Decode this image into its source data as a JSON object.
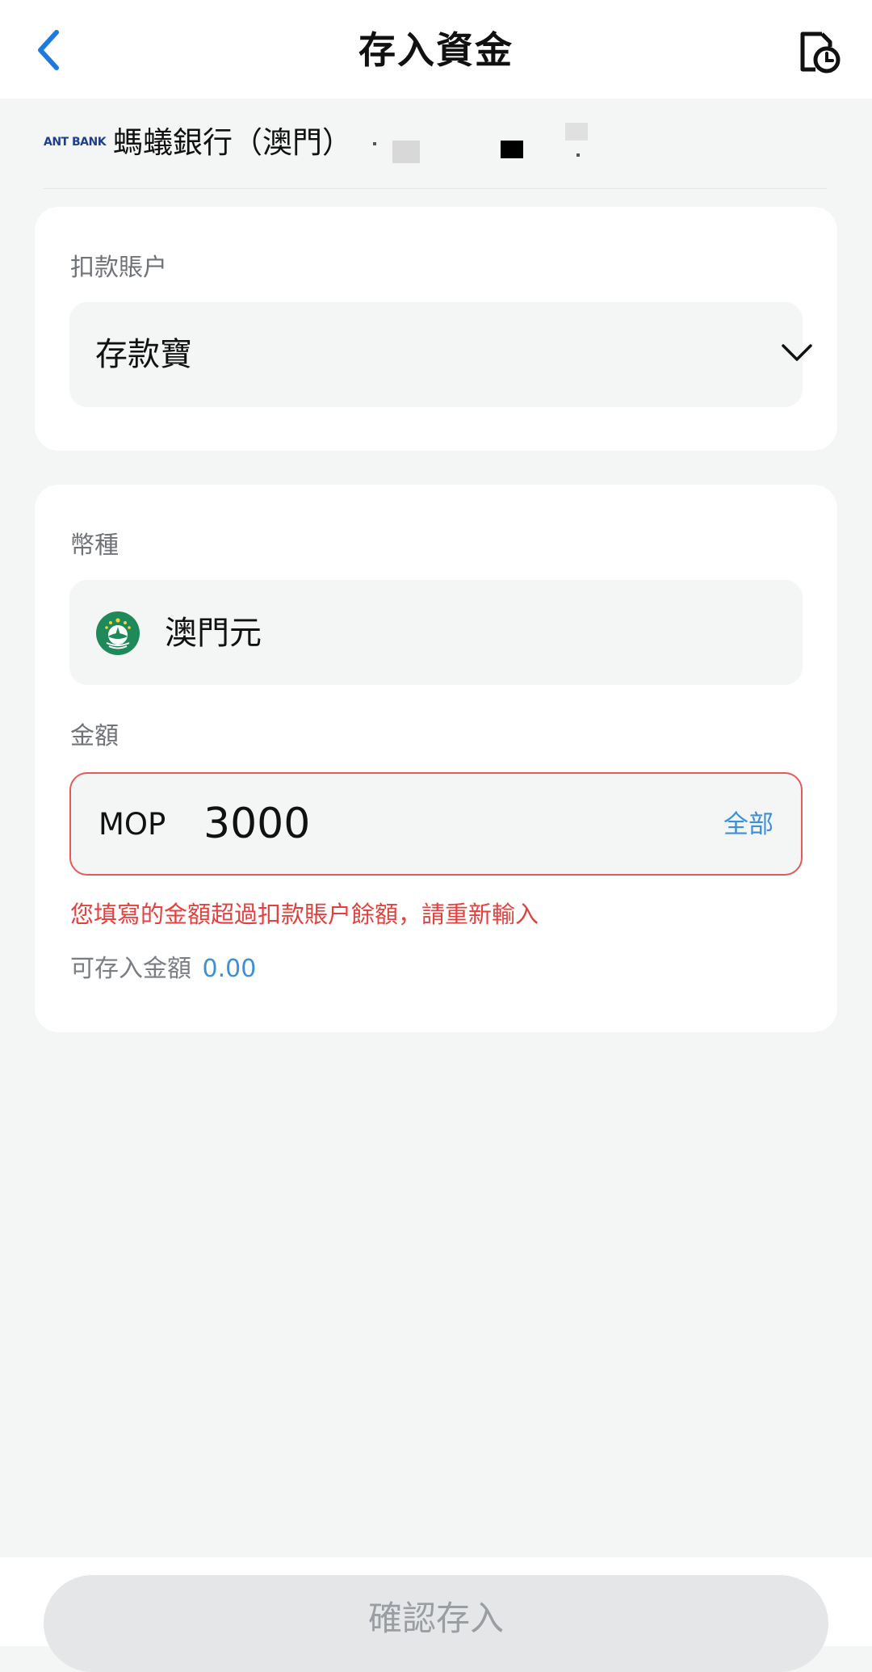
{
  "header": {
    "title": "存入資金",
    "back_icon": "chevron-left-icon",
    "history_icon": "record-history-icon"
  },
  "bank": {
    "logo_text": "ANT BANK",
    "name": "螞蟻銀行（澳門）"
  },
  "debit_account": {
    "label": "扣款賬户",
    "value": "存款寶"
  },
  "currency": {
    "label": "幣種",
    "value": "澳門元",
    "flag_icon": "macau-flag-icon"
  },
  "amount": {
    "label": "金額",
    "currency_code": "MOP",
    "value": "3000",
    "all_label": "全部",
    "error": "您填寫的金額超過扣款賬户餘額，請重新輸入",
    "available_label": "可存入金額",
    "available_value": "0.00"
  },
  "footer": {
    "confirm_label": "確認存入"
  },
  "colors": {
    "accent": "#3f8fd6",
    "error": "#e0423e",
    "background": "#f4f5f5"
  }
}
